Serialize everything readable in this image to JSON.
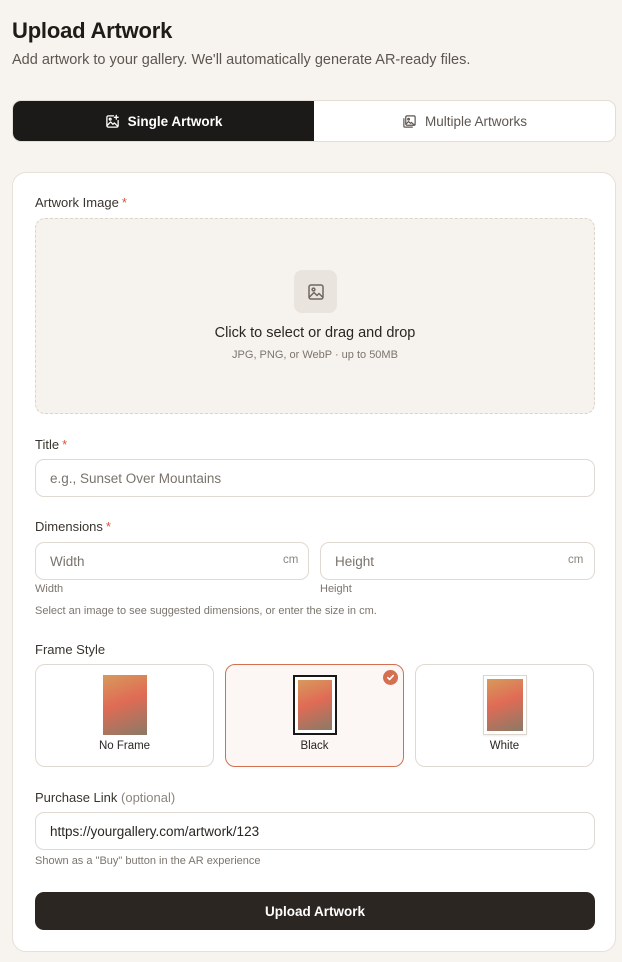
{
  "header": {
    "title": "Upload Artwork",
    "subtitle": "Add artwork to your gallery. We'll automatically generate AR-ready files."
  },
  "tabs": [
    {
      "label": "Single Artwork",
      "icon": "image-add-icon",
      "active": true
    },
    {
      "label": "Multiple Artworks",
      "icon": "images-stack-icon",
      "active": false
    }
  ],
  "form": {
    "artwork_image": {
      "label": "Artwork Image",
      "required_mark": "*",
      "drop_title": "Click to select or drag and drop",
      "drop_hint": "JPG, PNG, or WebP · up to 50MB",
      "icon": "image-icon"
    },
    "title": {
      "label": "Title",
      "required_mark": "*",
      "placeholder": "e.g., Sunset Over Mountains",
      "value": ""
    },
    "dimensions": {
      "label": "Dimensions",
      "required_mark": "*",
      "width": {
        "placeholder": "Width",
        "unit": "cm",
        "sublabel": "Width",
        "value": ""
      },
      "height": {
        "placeholder": "Height",
        "unit": "cm",
        "sublabel": "Height",
        "value": ""
      },
      "help": "Select an image to see suggested dimensions, or enter the size in cm."
    },
    "frame_style": {
      "label": "Frame Style",
      "options": [
        {
          "label": "No Frame",
          "selected": false
        },
        {
          "label": "Black",
          "selected": true
        },
        {
          "label": "White",
          "selected": false
        }
      ],
      "selected_color": "#d4704f"
    },
    "purchase_link": {
      "label": "Purchase Link",
      "optional_text": "(optional)",
      "value": "https://yourgallery.com/artwork/123",
      "help": "Shown as a \"Buy\" button in the AR experience"
    },
    "submit_label": "Upload Artwork"
  },
  "colors": {
    "background": "#f7f3ee",
    "primary_dark": "#1c1a18",
    "accent": "#d4704f",
    "required": "#d4573a"
  }
}
